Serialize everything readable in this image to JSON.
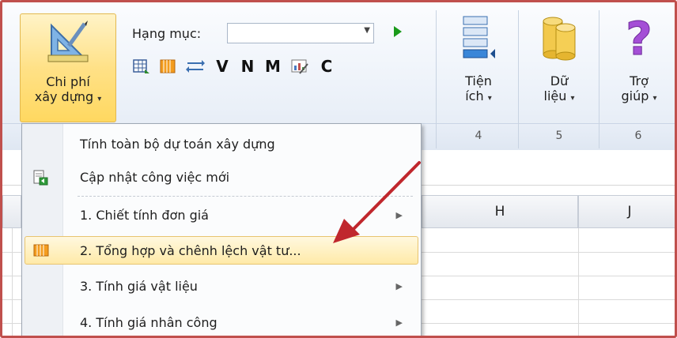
{
  "ribbon": {
    "main_button": {
      "line1": "Chi phí",
      "line2": "xây dựng"
    },
    "hang_muc_label": "Hạng mục:",
    "hang_muc_value": "",
    "toolbar_letters": [
      "V",
      "N",
      "M",
      "C"
    ],
    "groups": [
      {
        "line1": "Tiện",
        "line2": "ích",
        "number": "4"
      },
      {
        "line1": "Dữ",
        "line2": "liệu",
        "number": "5"
      },
      {
        "line1": "Trợ",
        "line2": "giúp",
        "number": "6"
      }
    ]
  },
  "sheet": {
    "columns": [
      "H",
      "J"
    ]
  },
  "menu": {
    "items": [
      {
        "label": "Tính toàn bộ dự toán xây dựng",
        "submenu": false
      },
      {
        "label": "Cập nhật công việc mới",
        "submenu": false
      },
      {
        "label": "1. Chiết tính đơn giá",
        "submenu": true
      },
      {
        "label": "2. Tổng hợp và chênh lệch vật tư...",
        "submenu": false,
        "highlighted": true
      },
      {
        "label": "3. Tính giá vật liệu",
        "submenu": true
      },
      {
        "label": "4. Tính giá nhân công",
        "submenu": true
      }
    ]
  },
  "colors": {
    "frame_border": "#c0504d",
    "arrow": "#c0272d",
    "highlight": "#ffe9a6"
  }
}
